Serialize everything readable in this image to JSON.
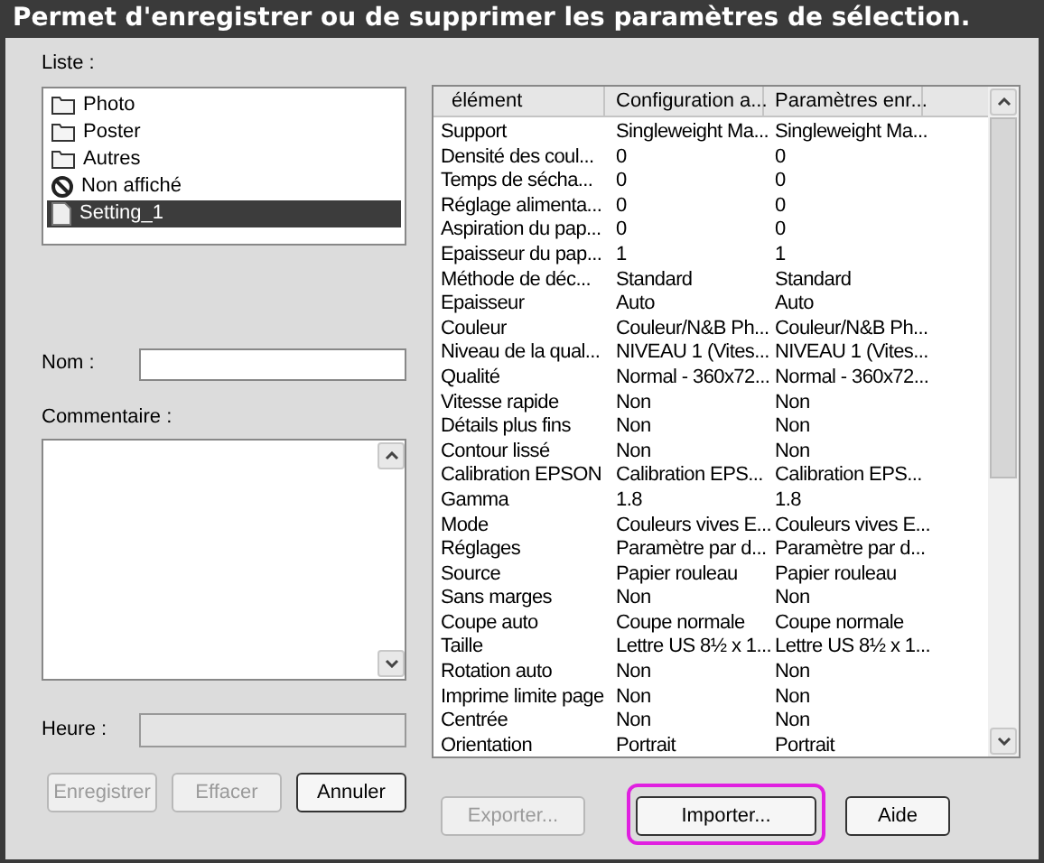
{
  "window": {
    "title": "Permet d'enregistrer ou de supprimer les paramètres de sélection."
  },
  "list": {
    "label": "Liste :",
    "items": [
      {
        "kind": "folder",
        "label": "Photo",
        "selected": false
      },
      {
        "kind": "folder",
        "label": "Poster",
        "selected": false
      },
      {
        "kind": "folder",
        "label": "Autres",
        "selected": false
      },
      {
        "kind": "hidden",
        "label": "Non affiché",
        "selected": false
      },
      {
        "kind": "setting",
        "label": "Setting_1",
        "selected": true
      }
    ]
  },
  "name_field": {
    "label": "Nom :"
  },
  "comment_field": {
    "label": "Commentaire :"
  },
  "time_field": {
    "label": "Heure :"
  },
  "left_buttons": [
    {
      "label": "Enregistrer",
      "disabled": true
    },
    {
      "label": "Effacer",
      "disabled": true
    },
    {
      "label": "Annuler",
      "disabled": false
    }
  ],
  "table": {
    "columns": [
      "élément",
      "Configuration a...",
      "Paramètres enr..."
    ],
    "rows": [
      [
        "Support",
        "Singleweight Ma...",
        "Singleweight Ma..."
      ],
      [
        "Densité des coul...",
        "0",
        "0"
      ],
      [
        "Temps de sécha...",
        "0",
        "0"
      ],
      [
        "Réglage alimenta...",
        "0",
        "0"
      ],
      [
        "Aspiration du pap...",
        "0",
        "0"
      ],
      [
        "Epaisseur du pap...",
        "1",
        "1"
      ],
      [
        "Méthode de déc...",
        "Standard",
        "Standard"
      ],
      [
        "Epaisseur",
        "Auto",
        "Auto"
      ],
      [
        "Couleur",
        "Couleur/N&B Ph...",
        "Couleur/N&B Ph..."
      ],
      [
        "Niveau de la qual...",
        "NIVEAU 1 (Vites...",
        "NIVEAU 1 (Vites..."
      ],
      [
        "Qualité",
        "Normal - 360x72...",
        "Normal - 360x72..."
      ],
      [
        "Vitesse rapide",
        "Non",
        "Non"
      ],
      [
        "Détails plus fins",
        "Non",
        "Non"
      ],
      [
        "Contour lissé",
        "Non",
        "Non"
      ],
      [
        "Calibration EPSON",
        "Calibration EPS...",
        "Calibration EPS..."
      ],
      [
        "Gamma",
        "1.8",
        "1.8"
      ],
      [
        "Mode",
        "Couleurs vives E...",
        "Couleurs vives E..."
      ],
      [
        "Réglages",
        "Paramètre par d...",
        "Paramètre par d..."
      ],
      [
        "Source",
        "Papier rouleau",
        "Papier rouleau"
      ],
      [
        "Sans marges",
        "Non",
        "Non"
      ],
      [
        "Coupe auto",
        "Coupe normale",
        "Coupe normale"
      ],
      [
        "Taille",
        "Lettre US 8½ x 1...",
        "Lettre US 8½ x 1..."
      ],
      [
        "Rotation auto",
        "Non",
        "Non"
      ],
      [
        "Imprime limite page",
        "Non",
        "Non"
      ],
      [
        "Centrée",
        "Non",
        "Non"
      ],
      [
        "Orientation",
        "Portrait",
        "Portrait"
      ]
    ]
  },
  "right_buttons": [
    {
      "label": "Exporter...",
      "disabled": true,
      "highlighted": false
    },
    {
      "label": "Importer...",
      "disabled": false,
      "highlighted": true
    },
    {
      "label": "Aide",
      "disabled": false,
      "highlighted": false
    }
  ]
}
